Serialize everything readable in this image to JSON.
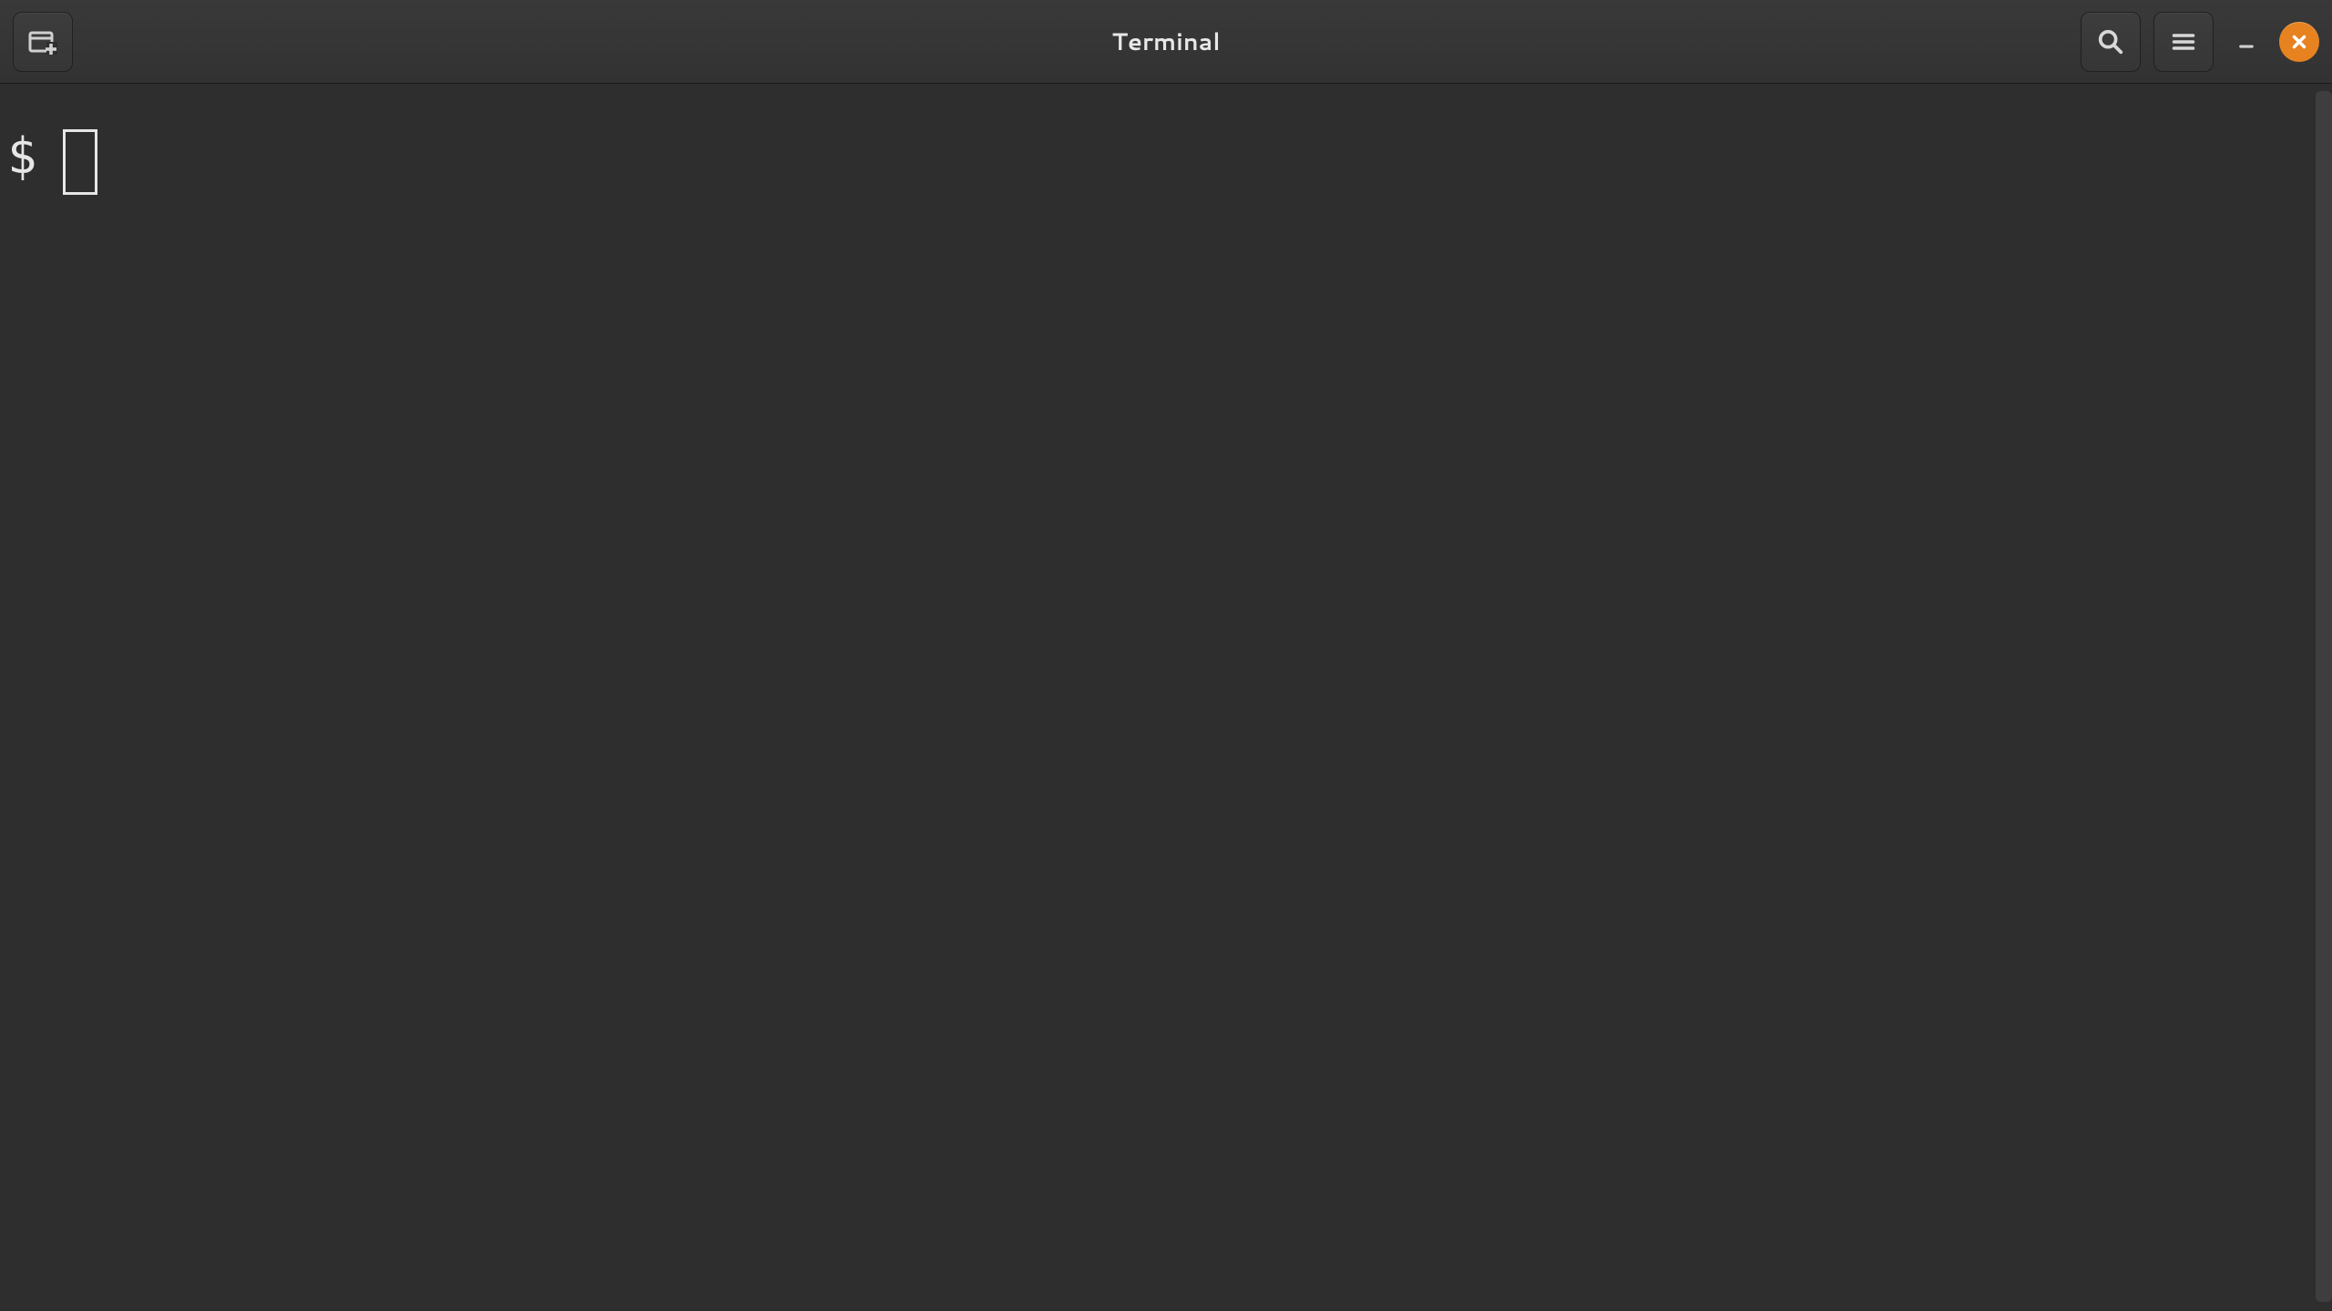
{
  "header": {
    "title": "Terminal"
  },
  "terminal": {
    "prompt": "$"
  },
  "icons": {
    "new_tab": "new-tab-icon",
    "search": "search-icon",
    "menu": "hamburger-menu-icon",
    "minimize": "minimize-icon",
    "close": "close-icon"
  }
}
